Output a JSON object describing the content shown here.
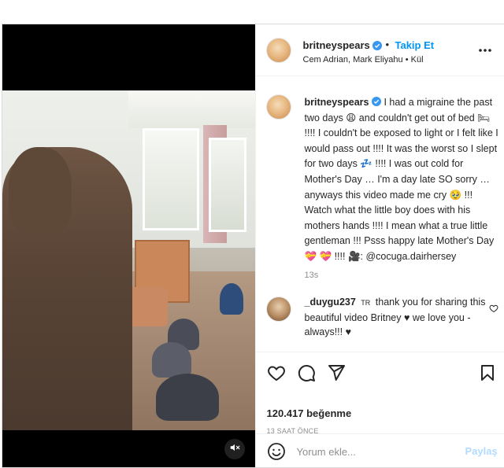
{
  "post": {
    "author": {
      "username": "britneyspears",
      "verified": true,
      "follow_label": "Takip Et",
      "audio_line": "Cem Adrian, Mark Eliyahu • Kül",
      "avatar_icon": "avatar"
    },
    "more_icon": "more-options-icon",
    "caption": {
      "username": "britneyspears",
      "text": "I had a migraine the past two days 😩 and couldn't get out of bed 🛏 !!!! I couldn't be exposed to light or I felt like I would pass out !!!! It was the worst so I slept for two days 💤 !!!! I was out cold for Mother's Day … I'm a day late SO sorry … anyways this video made me cry 🥹 !!! Watch what the little boy does with his mothers hands !!!! I mean what a true little gentleman !!! Psss happy late Mother's Day 💝 💝 !!!! 🎥: @cocuga.dairhersey",
      "time": "13s"
    },
    "comment": {
      "username": "_duygu237",
      "lang": "TR",
      "text": "thank you for sharing this beautiful video Britney ♥ we love you - always!!! ♥"
    },
    "actions": {
      "like_icon": "heart-icon",
      "comment_icon": "comment-icon",
      "share_icon": "send-icon",
      "save_icon": "bookmark-icon"
    },
    "likes": "120.417 beğenme",
    "posted_ago": "13 SAAT ÖNCE",
    "add_comment": {
      "placeholder": "Yorum ekle...",
      "share_label": "Paylaş",
      "emoji_icon": "emoji-icon"
    },
    "video": {
      "mute_icon": "muted-speaker-icon"
    }
  },
  "colors": {
    "accent": "#0095f6",
    "verified": "#3897f0",
    "muted_text": "#8e8e8e",
    "share_disabled": "#b3dbff"
  }
}
